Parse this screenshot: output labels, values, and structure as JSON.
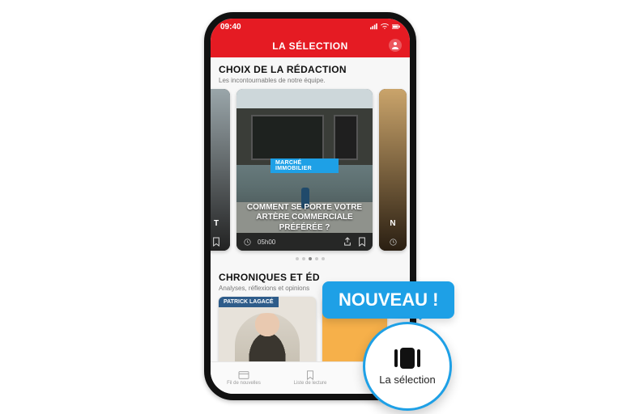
{
  "status": {
    "time": "09:40"
  },
  "header": {
    "title": "LA SÉLECTION"
  },
  "redaction": {
    "title": "CHOIX DE LA RÉDACTION",
    "subtitle": "Les incontournables de notre équipe.",
    "main_card": {
      "tag": "MARCHÉ IMMOBILIER",
      "headline": "COMMENT SE PORTE VOTRE ARTÈRE COMMERCIALE PRÉFÉRÉE ?",
      "time": "05h00"
    },
    "side_right_title_fragment": "N",
    "side_left_time_fragment": "T"
  },
  "chroniques": {
    "title": "CHRONIQUES ET ÉD",
    "subtitle": "Analyses, réflexions et opinions",
    "author": "PATRICK LAGACÉ"
  },
  "nav": {
    "item1": "Fil de nouvelles",
    "item2": "Liste de lecture"
  },
  "callout": {
    "bubble": "NOUVEAU !",
    "circle_label": "La sélection"
  },
  "colors": {
    "brand_red": "#e51b23",
    "accent_blue": "#1ea0e6"
  }
}
